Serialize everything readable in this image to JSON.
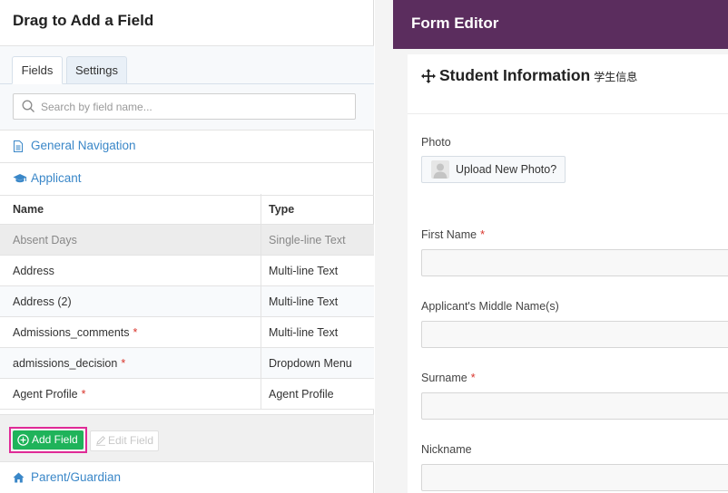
{
  "left_panel": {
    "title": "Drag to Add a Field",
    "tabs": [
      {
        "label": "Fields",
        "active": true
      },
      {
        "label": "Settings",
        "active": false
      }
    ],
    "search": {
      "placeholder": "Search by field name..."
    },
    "sections": {
      "general": {
        "label": "General Navigation",
        "icon": "document-icon"
      },
      "applicant": {
        "label": "Applicant",
        "icon": "graduation-cap-icon"
      },
      "parent": {
        "label": "Parent/Guardian",
        "icon": "home-icon"
      }
    },
    "table": {
      "columns": [
        "Name",
        "Type"
      ],
      "rows": [
        {
          "name": "Absent Days",
          "type": "Single-line Text",
          "required": false,
          "selected": true
        },
        {
          "name": "Address",
          "type": "Multi-line Text",
          "required": false
        },
        {
          "name": "Address (2)",
          "type": "Multi-line Text",
          "required": false
        },
        {
          "name": "Admissions_comments",
          "type": "Multi-line Text",
          "required": true
        },
        {
          "name": "admissions_decision",
          "type": "Dropdown Menu",
          "required": true
        },
        {
          "name": "Agent Profile",
          "type": "Agent Profile",
          "required": true
        }
      ]
    },
    "buttons": {
      "add": "Add Field",
      "edit": "Edit Field"
    },
    "required_marker": "*"
  },
  "editor": {
    "title": "Form Editor",
    "card": {
      "title": "Student Information",
      "subtitle": "学生信息",
      "fields": {
        "photo_label": "Photo",
        "photo_button": "Upload New Photo?",
        "first_name": "First Name",
        "middle_name": "Applicant's Middle Name(s)",
        "surname": "Surname",
        "nickname": "Nickname"
      }
    }
  },
  "colors": {
    "header_purple": "#5b2d5e",
    "link_blue": "#3a87c8",
    "add_green": "#1fb35a",
    "highlight_pink": "#e02a97",
    "required_red": "#d9342b"
  }
}
